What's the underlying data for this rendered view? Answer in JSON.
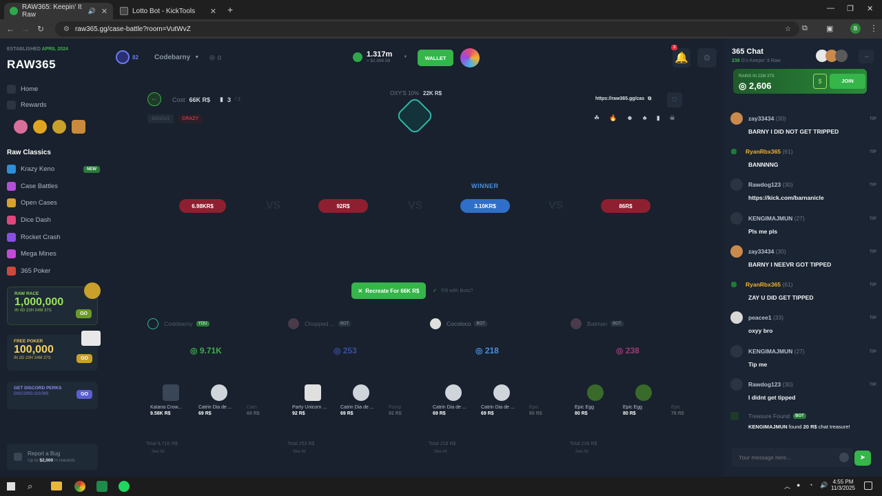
{
  "browser": {
    "tabs": [
      {
        "title": "RAW365: Keepin' It Raw",
        "active": true
      },
      {
        "title": "Lotto Bot - KickTools",
        "active": false
      }
    ],
    "url": "raw365.gg/case-battle?room=VutWvZ"
  },
  "sidebar": {
    "established": "ESTABLISHED",
    "established_date": "APRIL 2024",
    "logo": "RAW365",
    "nav": [
      "Home",
      "Rewards"
    ],
    "section_title": "Raw Classics",
    "games": [
      {
        "label": "Krazy Keno",
        "badge": "NEW",
        "color": "#2e8fd6"
      },
      {
        "label": "Case Battles",
        "color": "#b24fd8"
      },
      {
        "label": "Open Cases",
        "color": "#d8a12c"
      },
      {
        "label": "Dice Dash",
        "color": "#e0457b"
      },
      {
        "label": "Rocket Crash",
        "color": "#8a4fe0"
      },
      {
        "label": "Mega Mines",
        "color": "#c24ad6"
      },
      {
        "label": "365 Poker",
        "color": "#d0473b"
      }
    ],
    "raw_race": {
      "title": "RAW RACE",
      "amount": "1,000,000",
      "timer": "IN 4D 23H 04M 37S",
      "cta": "GO"
    },
    "free_poker": {
      "title": "FREE POKER",
      "amount": "100,000",
      "timer": "IN 2D 23H 34M 37S",
      "cta": "GO"
    },
    "discord": {
      "title": "GET DISCORD PERKS",
      "link": "DISCORD.GG/365",
      "cta": "GO"
    },
    "report": {
      "title": "Report a Bug",
      "sub_prefix": "Up to ",
      "sub_amount": "$2,000",
      "sub_suffix": " in rewards"
    }
  },
  "header": {
    "level": "82",
    "username": "Codebarny",
    "counter": "0",
    "balance": "1.317m",
    "balance_usd": "≈ $2,896.58",
    "wallet": "WALLET",
    "notif_count": "3"
  },
  "battle": {
    "cost_label": "Cost",
    "cost": "66K R$",
    "players": "3",
    "players_max": "/ 3",
    "mode": "1v1v1v1",
    "tag": "CRAZY",
    "oxy_label": "OXY'S 10%",
    "oxy_value": "22K R$",
    "share_link": "https://raw365.gg/cas",
    "winner_label": "WINNER",
    "slots": [
      {
        "value": "6.98KR$",
        "color": "#b3263b"
      },
      {
        "value": "92R$",
        "color": "#b3263b"
      },
      {
        "value": "3.10KR$",
        "color": "#2f6fc9"
      },
      {
        "value": "86R$",
        "color": "#b3263b"
      }
    ],
    "vs": "VS",
    "recreate": "Recreate For 66K R$",
    "fill_bots": "Fill with Bots?"
  },
  "players": [
    {
      "name": "Codebarny",
      "badge": "YOU",
      "total": "9.71K",
      "total_color": "#3fae4a",
      "items": [
        {
          "name": "Katana Crow...",
          "price": "9.58K R$"
        },
        {
          "name": "Catrin Dia de ...",
          "price": "69 R$"
        },
        {
          "name": "Catri",
          "price": "69 R$"
        }
      ],
      "footer_total": "Total 9.71K R$"
    },
    {
      "name": "Chopped ...",
      "badge": "BOT",
      "total": "253",
      "total_color": "#3a4fa0",
      "items": [
        {
          "name": "Party Unicorn ...",
          "price": "92 R$"
        },
        {
          "name": "Catrin Dia de ...",
          "price": "69 R$"
        },
        {
          "name": "Pump",
          "price": "92 R$"
        }
      ],
      "footer_total": "Total 253 R$"
    },
    {
      "name": "Cocoloco",
      "badge": "BOT",
      "total": "218",
      "total_color": "#4a8fe0",
      "items": [
        {
          "name": "Catrin Dia de ...",
          "price": "69 R$"
        },
        {
          "name": "Catrin Dia de ...",
          "price": "69 R$"
        },
        {
          "name": "Epic",
          "price": "80 R$"
        }
      ],
      "footer_total": "Total 218 R$"
    },
    {
      "name": "Batman",
      "badge": "BOT",
      "total": "238",
      "total_color": "#a03a7a",
      "items": [
        {
          "name": "Epic Egg",
          "price": "80 R$"
        },
        {
          "name": "Epic Egg",
          "price": "80 R$"
        },
        {
          "name": "Epic",
          "price": "78 R$"
        }
      ],
      "footer_total": "Total 238 R$"
    }
  ],
  "see_all": "See All",
  "chat": {
    "title": "365 Chat",
    "online_count": "238",
    "online_label": "G's Keepin' It Raw",
    "rain_label": "RAINS IN",
    "rain_timer": "22M 37S",
    "rain_amount": "2,606",
    "join": "JOIN",
    "tip": "TIP",
    "messages": [
      {
        "user": "zay33434",
        "level": "(30)",
        "text": "BARNY I DID NOT GET TRIPPED",
        "color": "#c98a4b"
      },
      {
        "user": "RyanRbx365",
        "level": "(61)",
        "text": "BANNNNG",
        "color": "#1f7a35",
        "highlight": true
      },
      {
        "user": "Rawdog123",
        "level": "(30)",
        "text": "https://kick.com/barnanicle",
        "color": "#2b3441"
      },
      {
        "user": "KENGIMAJMUN",
        "level": "(27)",
        "text": "Pls me pls",
        "color": "#2b3441"
      },
      {
        "user": "zay33434",
        "level": "(30)",
        "text": "BARNY I NEEVR GOT TIPPED",
        "color": "#c98a4b"
      },
      {
        "user": "RyanRbx365",
        "level": "(61)",
        "text": "ZAY U DID GET TIPPED",
        "color": "#1f7a35",
        "highlight": true
      },
      {
        "user": "peacee1",
        "level": "(33)",
        "text": "oxyy bro",
        "color": "#d8d8d8"
      },
      {
        "user": "KENGIMAJMUN",
        "level": "(27)",
        "text": "Tip me",
        "color": "#2b3441"
      },
      {
        "user": "Rawdog123",
        "level": "(30)",
        "text": "I didnt get tipped",
        "color": "#2b3441"
      }
    ],
    "treasure_title": "Treasure Found",
    "treasure_badge": "BOT",
    "treasure_user": "KENGIMAJMUN",
    "treasure_mid": "found",
    "treasure_amount": "20 R$",
    "treasure_end": "chat treasure!",
    "input_placeholder": "Your message here..."
  },
  "taskbar": {
    "time": "4:55 PM",
    "date": "11/3/2025"
  }
}
